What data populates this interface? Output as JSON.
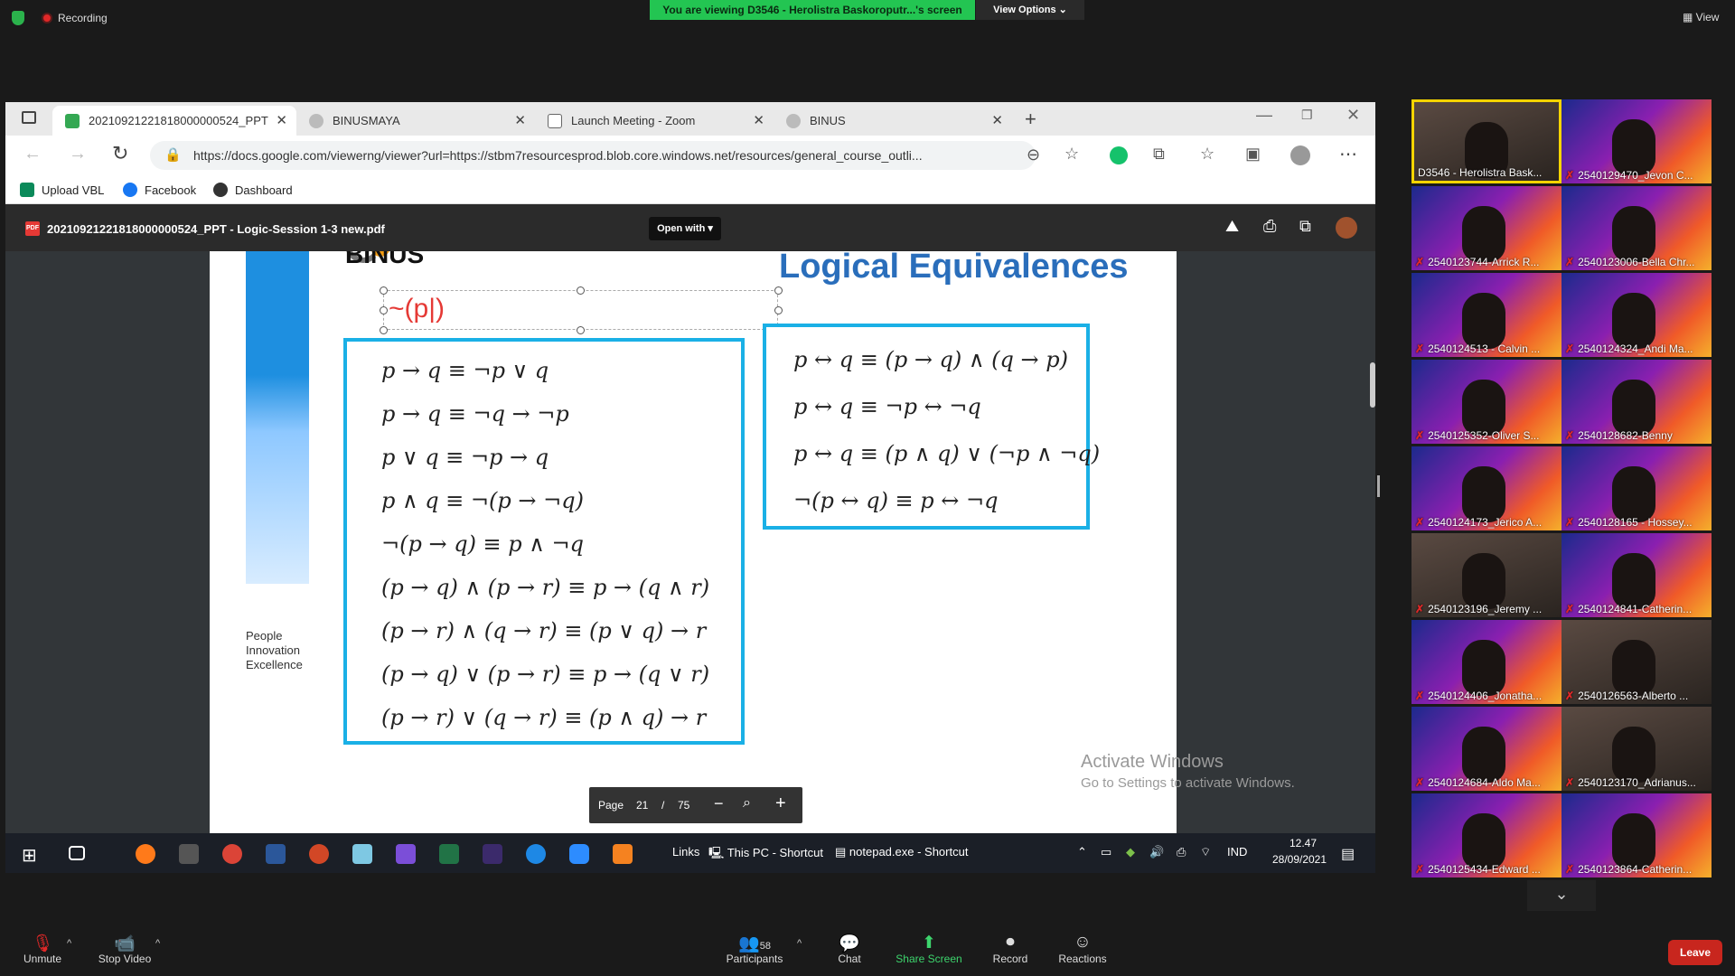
{
  "zoom_top": {
    "recording_label": "Recording",
    "viewing_banner": "You are viewing D3546 - Herolistra Baskoroputr...'s screen",
    "view_options_label": "View Options ⌄",
    "view_label": "View"
  },
  "browser": {
    "tabs": [
      {
        "label": "20210921221818000000524_PPT",
        "icon_color": "#34a853",
        "active": true
      },
      {
        "label": "BINUSMAYA",
        "icon_color": "#bbbbbb",
        "active": false
      },
      {
        "label": "Launch Meeting - Zoom",
        "icon_color": "#dddddd",
        "active": false
      },
      {
        "label": "BINUS",
        "icon_color": "#bbbbbb",
        "active": false
      }
    ],
    "url": "https://docs.google.com/viewerng/viewer?url=https://stbm7resourcesprod.blob.core.windows.net/resources/general_course_outli...",
    "bookmarks": [
      {
        "label": "Upload VBL",
        "icon_color": "#0b8a5a"
      },
      {
        "label": "Facebook",
        "icon_color": "#1877f2"
      },
      {
        "label": "Dashboard",
        "icon_color": "#333333"
      }
    ]
  },
  "viewer": {
    "pdf_badge": "PDF",
    "file_title": "20210921221818000000524_PPT - Logic-Session 1-3 new.pdf",
    "open_with_label": "Open with ▾",
    "slide": {
      "logo_text": "BINUS",
      "title": "Logical Equivalences",
      "edit_text": "~(p|)",
      "tagline": "People Innovation Excellence",
      "left_equations": [
        "p → q ≡ ¬p ∨ q",
        "p → q ≡ ¬q → ¬p",
        "p ∨ q ≡ ¬p → q",
        "p ∧ q ≡ ¬(p → ¬q)",
        "¬(p → q) ≡ p ∧ ¬q",
        "(p → q) ∧ (p → r) ≡ p → (q ∧ r)",
        "(p → r) ∧ (q → r) ≡ (p ∨ q) → r",
        "(p → q) ∨ (p → r) ≡ p → (q ∨ r)",
        "(p → r) ∨ (q → r) ≡ (p ∧ q) → r"
      ],
      "right_equations": [
        "p ↔ q ≡ (p → q) ∧ (q → p)",
        "p ↔ q ≡ ¬p ↔ ¬q",
        "p ↔ q ≡ (p ∧ q) ∨ (¬p ∧ ¬q)",
        "¬(p ↔ q) ≡ p ↔ ¬q"
      ]
    },
    "pagebar": {
      "page_label": "Page",
      "current": "21",
      "separator": "/",
      "total": "75"
    },
    "activate_title": "Activate Windows",
    "activate_sub": "Go to Settings to activate Windows."
  },
  "taskbar": {
    "links_label": "Links",
    "thispc_label": "This PC - Shortcut",
    "notepad_label": "notepad.exe - Shortcut",
    "lang": "IND",
    "time": "12.47",
    "date": "28/09/2021"
  },
  "gallery": [
    {
      "name": "D3546 - Herolistra Bask...",
      "camera": true,
      "muted": false
    },
    {
      "name": "2540129470_Jevon C...",
      "camera": false,
      "muted": true
    },
    {
      "name": "2540123744-Arrick R...",
      "camera": false,
      "muted": true
    },
    {
      "name": "2540123006-Bella Chr...",
      "camera": false,
      "muted": true
    },
    {
      "name": "2540124513 - Calvin ...",
      "camera": false,
      "muted": true
    },
    {
      "name": "2540124324_Andi Ma...",
      "camera": false,
      "muted": true
    },
    {
      "name": "2540125352-Oliver S...",
      "camera": false,
      "muted": true
    },
    {
      "name": "2540128682-Benny",
      "camera": false,
      "muted": true
    },
    {
      "name": "2540124173_Jerico A...",
      "camera": false,
      "muted": true
    },
    {
      "name": "2540128165 - Hossey...",
      "camera": false,
      "muted": true
    },
    {
      "name": "2540123196_Jeremy ...",
      "camera": true,
      "muted": true
    },
    {
      "name": "2540124841-Catherin...",
      "camera": false,
      "muted": true
    },
    {
      "name": "2540124406_Jonatha...",
      "camera": false,
      "muted": true
    },
    {
      "name": "2540126563-Alberto ...",
      "camera": true,
      "muted": true
    },
    {
      "name": "2540124684-Aldo Ma...",
      "camera": false,
      "muted": true
    },
    {
      "name": "2540123170_Adrianus...",
      "camera": true,
      "muted": true
    },
    {
      "name": "2540125434-Edward ...",
      "camera": false,
      "muted": true
    },
    {
      "name": "2540123864-Catherin...",
      "camera": false,
      "muted": true
    }
  ],
  "toolbar": {
    "unmute": "Unmute",
    "stop_video": "Stop Video",
    "participants": "Participants",
    "participants_count": "58",
    "chat": "Chat",
    "share_screen": "Share Screen",
    "record": "Record",
    "reactions": "Reactions",
    "leave": "Leave"
  }
}
